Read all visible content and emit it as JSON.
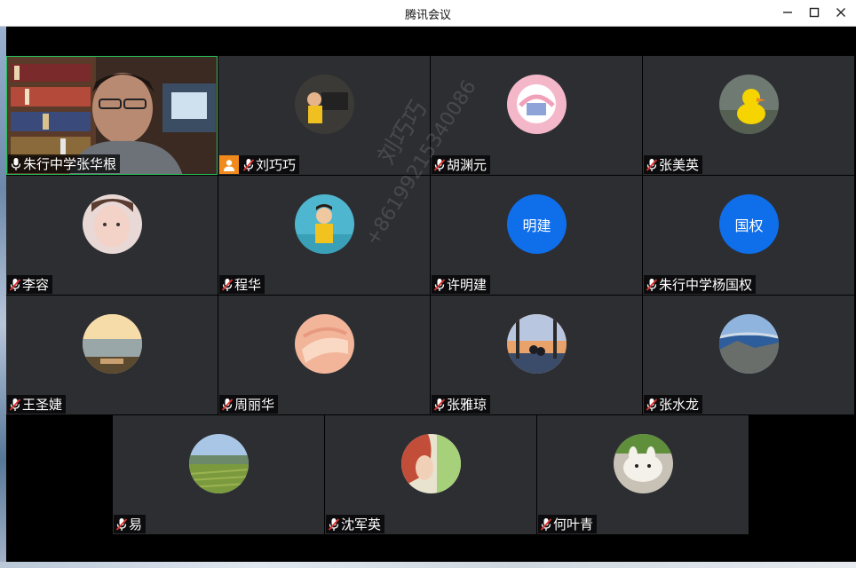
{
  "window": {
    "title": "腾讯会议",
    "minimize_glyph": "—",
    "maximize_glyph": "☐",
    "close_glyph": "✕"
  },
  "watermark": {
    "name": "刘巧巧",
    "phone": "+86199215340086"
  },
  "participants": [
    {
      "name": "朱行中学张华根",
      "video": true
    },
    {
      "name": "刘巧巧",
      "host": true
    },
    {
      "name": "胡渊元"
    },
    {
      "name": "张美英"
    },
    {
      "name": "李容"
    },
    {
      "name": "程华"
    },
    {
      "name": "许明建",
      "initials": "明建"
    },
    {
      "name": "朱行中学杨国权",
      "initials": "国权"
    },
    {
      "name": "王圣婕"
    },
    {
      "name": "周丽华"
    },
    {
      "name": "张雅琼"
    },
    {
      "name": "张水龙"
    },
    {
      "name": "易"
    },
    {
      "name": "沈军英"
    },
    {
      "name": "何叶青"
    }
  ],
  "colors": {
    "tile_bg": "#2c2e32",
    "initials_avatar": "#0f6eea",
    "host_badge": "#f08a1c",
    "active_border": "#28c45b"
  }
}
